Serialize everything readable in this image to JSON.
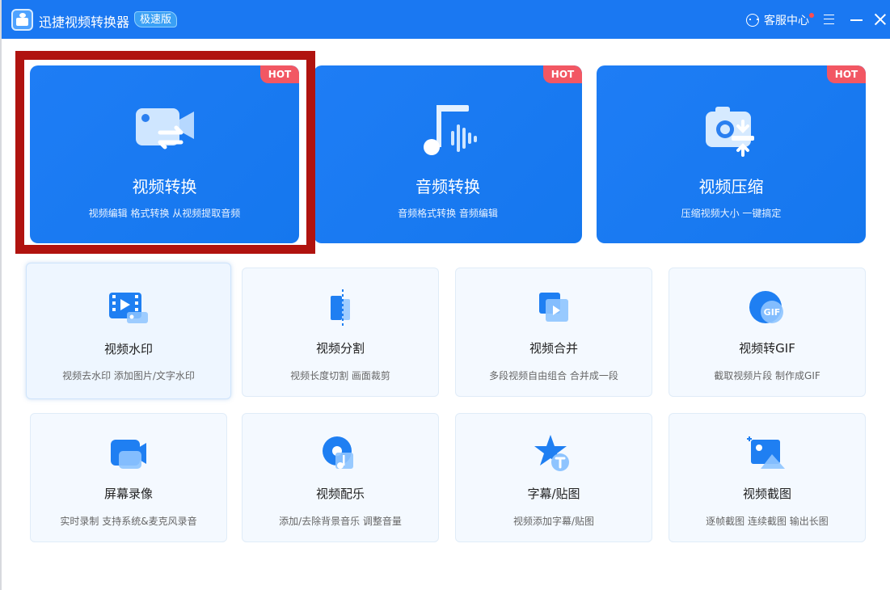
{
  "titlebar": {
    "app_title": "迅捷视频转换器",
    "edition_badge": "极速版",
    "support_label": "客服中心"
  },
  "featured_tools": [
    {
      "title": "视频转换",
      "subtitle": "视频编辑 格式转换 从视频提取音频",
      "badge": "HOT",
      "icon": "video-convert-icon"
    },
    {
      "title": "音频转换",
      "subtitle": "音频格式转换 音频编辑",
      "badge": "HOT",
      "icon": "music-note-icon"
    },
    {
      "title": "视频压缩",
      "subtitle": "压缩视频大小 一键搞定",
      "badge": "HOT",
      "icon": "camera-compress-icon"
    }
  ],
  "tools": [
    {
      "title": "视频水印",
      "subtitle": "视频去水印 添加图片/文字水印",
      "icon": "video-watermark-icon"
    },
    {
      "title": "视频分割",
      "subtitle": "视频长度切割 画面裁剪",
      "icon": "video-split-icon"
    },
    {
      "title": "视频合并",
      "subtitle": "多段视频自由组合 合并成一段",
      "icon": "video-merge-icon"
    },
    {
      "title": "视频转GIF",
      "subtitle": "截取视频片段 制作成GIF",
      "icon": "gif-icon"
    },
    {
      "title": "屏幕录像",
      "subtitle": "实时录制 支持系统&麦克风录音",
      "icon": "screen-record-icon"
    },
    {
      "title": "视频配乐",
      "subtitle": "添加/去除背景音乐 调整音量",
      "icon": "music-disc-icon"
    },
    {
      "title": "字幕/贴图",
      "subtitle": "视频添加字幕/贴图",
      "icon": "subtitle-star-icon"
    },
    {
      "title": "视频截图",
      "subtitle": "逐帧截图 连续截图 输出长图",
      "icon": "screenshot-image-icon"
    }
  ],
  "colors": {
    "accent": "#1a78f2",
    "hot_badge": "#f25763",
    "highlight_frame": "#b0130f"
  }
}
